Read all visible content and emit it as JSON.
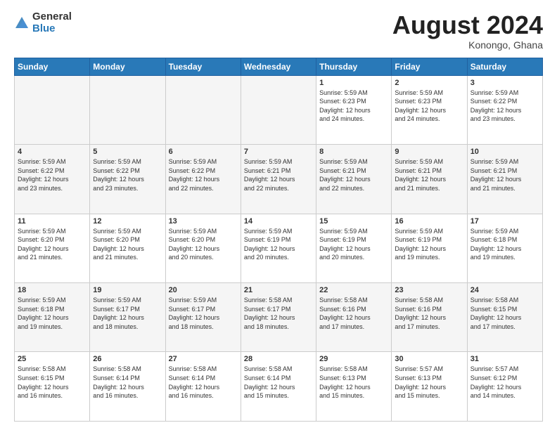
{
  "header": {
    "logo_general": "General",
    "logo_blue": "Blue",
    "title": "August 2024",
    "location": "Konongo, Ghana"
  },
  "days_of_week": [
    "Sunday",
    "Monday",
    "Tuesday",
    "Wednesday",
    "Thursday",
    "Friday",
    "Saturday"
  ],
  "weeks": [
    [
      {
        "num": "",
        "info": ""
      },
      {
        "num": "",
        "info": ""
      },
      {
        "num": "",
        "info": ""
      },
      {
        "num": "",
        "info": ""
      },
      {
        "num": "1",
        "info": "Sunrise: 5:59 AM\nSunset: 6:23 PM\nDaylight: 12 hours\nand 24 minutes."
      },
      {
        "num": "2",
        "info": "Sunrise: 5:59 AM\nSunset: 6:23 PM\nDaylight: 12 hours\nand 24 minutes."
      },
      {
        "num": "3",
        "info": "Sunrise: 5:59 AM\nSunset: 6:22 PM\nDaylight: 12 hours\nand 23 minutes."
      }
    ],
    [
      {
        "num": "4",
        "info": "Sunrise: 5:59 AM\nSunset: 6:22 PM\nDaylight: 12 hours\nand 23 minutes."
      },
      {
        "num": "5",
        "info": "Sunrise: 5:59 AM\nSunset: 6:22 PM\nDaylight: 12 hours\nand 23 minutes."
      },
      {
        "num": "6",
        "info": "Sunrise: 5:59 AM\nSunset: 6:22 PM\nDaylight: 12 hours\nand 22 minutes."
      },
      {
        "num": "7",
        "info": "Sunrise: 5:59 AM\nSunset: 6:21 PM\nDaylight: 12 hours\nand 22 minutes."
      },
      {
        "num": "8",
        "info": "Sunrise: 5:59 AM\nSunset: 6:21 PM\nDaylight: 12 hours\nand 22 minutes."
      },
      {
        "num": "9",
        "info": "Sunrise: 5:59 AM\nSunset: 6:21 PM\nDaylight: 12 hours\nand 21 minutes."
      },
      {
        "num": "10",
        "info": "Sunrise: 5:59 AM\nSunset: 6:21 PM\nDaylight: 12 hours\nand 21 minutes."
      }
    ],
    [
      {
        "num": "11",
        "info": "Sunrise: 5:59 AM\nSunset: 6:20 PM\nDaylight: 12 hours\nand 21 minutes."
      },
      {
        "num": "12",
        "info": "Sunrise: 5:59 AM\nSunset: 6:20 PM\nDaylight: 12 hours\nand 21 minutes."
      },
      {
        "num": "13",
        "info": "Sunrise: 5:59 AM\nSunset: 6:20 PM\nDaylight: 12 hours\nand 20 minutes."
      },
      {
        "num": "14",
        "info": "Sunrise: 5:59 AM\nSunset: 6:19 PM\nDaylight: 12 hours\nand 20 minutes."
      },
      {
        "num": "15",
        "info": "Sunrise: 5:59 AM\nSunset: 6:19 PM\nDaylight: 12 hours\nand 20 minutes."
      },
      {
        "num": "16",
        "info": "Sunrise: 5:59 AM\nSunset: 6:19 PM\nDaylight: 12 hours\nand 19 minutes."
      },
      {
        "num": "17",
        "info": "Sunrise: 5:59 AM\nSunset: 6:18 PM\nDaylight: 12 hours\nand 19 minutes."
      }
    ],
    [
      {
        "num": "18",
        "info": "Sunrise: 5:59 AM\nSunset: 6:18 PM\nDaylight: 12 hours\nand 19 minutes."
      },
      {
        "num": "19",
        "info": "Sunrise: 5:59 AM\nSunset: 6:17 PM\nDaylight: 12 hours\nand 18 minutes."
      },
      {
        "num": "20",
        "info": "Sunrise: 5:59 AM\nSunset: 6:17 PM\nDaylight: 12 hours\nand 18 minutes."
      },
      {
        "num": "21",
        "info": "Sunrise: 5:58 AM\nSunset: 6:17 PM\nDaylight: 12 hours\nand 18 minutes."
      },
      {
        "num": "22",
        "info": "Sunrise: 5:58 AM\nSunset: 6:16 PM\nDaylight: 12 hours\nand 17 minutes."
      },
      {
        "num": "23",
        "info": "Sunrise: 5:58 AM\nSunset: 6:16 PM\nDaylight: 12 hours\nand 17 minutes."
      },
      {
        "num": "24",
        "info": "Sunrise: 5:58 AM\nSunset: 6:15 PM\nDaylight: 12 hours\nand 17 minutes."
      }
    ],
    [
      {
        "num": "25",
        "info": "Sunrise: 5:58 AM\nSunset: 6:15 PM\nDaylight: 12 hours\nand 16 minutes."
      },
      {
        "num": "26",
        "info": "Sunrise: 5:58 AM\nSunset: 6:14 PM\nDaylight: 12 hours\nand 16 minutes."
      },
      {
        "num": "27",
        "info": "Sunrise: 5:58 AM\nSunset: 6:14 PM\nDaylight: 12 hours\nand 16 minutes."
      },
      {
        "num": "28",
        "info": "Sunrise: 5:58 AM\nSunset: 6:14 PM\nDaylight: 12 hours\nand 15 minutes."
      },
      {
        "num": "29",
        "info": "Sunrise: 5:58 AM\nSunset: 6:13 PM\nDaylight: 12 hours\nand 15 minutes."
      },
      {
        "num": "30",
        "info": "Sunrise: 5:57 AM\nSunset: 6:13 PM\nDaylight: 12 hours\nand 15 minutes."
      },
      {
        "num": "31",
        "info": "Sunrise: 5:57 AM\nSunset: 6:12 PM\nDaylight: 12 hours\nand 14 minutes."
      }
    ]
  ]
}
